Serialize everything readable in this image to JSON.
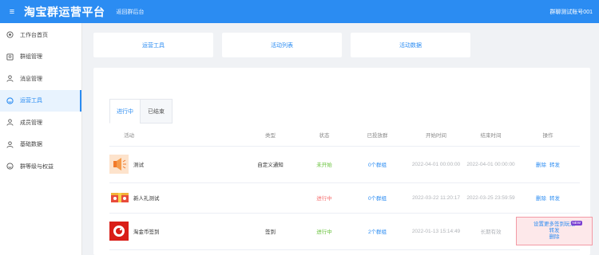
{
  "header": {
    "menu_icon": "menu-icon",
    "title": "淘宝群运营平台",
    "back_link": "返回群后台",
    "account": "群聊测试账号001"
  },
  "sidebar": {
    "items": [
      {
        "label": "工作台首页",
        "icon": "home-icon"
      },
      {
        "label": "群组管理",
        "icon": "group-icon"
      },
      {
        "label": "消息管理",
        "icon": "user-icon"
      },
      {
        "label": "运营工具",
        "icon": "smile-icon",
        "active": true
      },
      {
        "label": "成员管理",
        "icon": "user-icon"
      },
      {
        "label": "基础数据",
        "icon": "user-icon"
      },
      {
        "label": "群等级与权益",
        "icon": "smile-icon"
      }
    ]
  },
  "cards": [
    "运营工具",
    "活动列表",
    "活动数据"
  ],
  "tabs": [
    "进行中",
    "已结束"
  ],
  "table": {
    "columns": [
      "活动",
      "类型",
      "状态",
      "已投放群",
      "开始时间",
      "结束时间",
      "操作"
    ],
    "rows": [
      {
        "name": "测试",
        "thumb": "megaphone-icon",
        "type": "自定义通知",
        "status": "未开始",
        "groups": "0个群组",
        "start": "2022-04-01 00:00:00",
        "end": "2022-04-01 00:00:00",
        "ops": [
          "删除",
          "转发"
        ]
      },
      {
        "name": "新人礼测试",
        "thumb": "gift-icon",
        "type": "",
        "status": "进行中",
        "groups": "0个群组",
        "start": "2022-03-22 11:20:17",
        "end": "2022-03-25 23:59:59",
        "ops": [
          "删除",
          "转发"
        ]
      },
      {
        "name": "淘金币签到",
        "thumb": "coin-icon",
        "type": "签到",
        "status": "进行中",
        "groups": "2个群组",
        "start": "2022-01-13 15:14:49",
        "end": "长期有效",
        "ops_box": {
          "line1": "设置更多签到玩法",
          "badge": "NEW",
          "line2": "转发",
          "line3": "删除"
        }
      }
    ]
  },
  "colors": {
    "primary": "#2b8cf2",
    "header_bg": "#2b8cf2",
    "status_green": "#67c23a",
    "status_red": "#f56c6c"
  }
}
